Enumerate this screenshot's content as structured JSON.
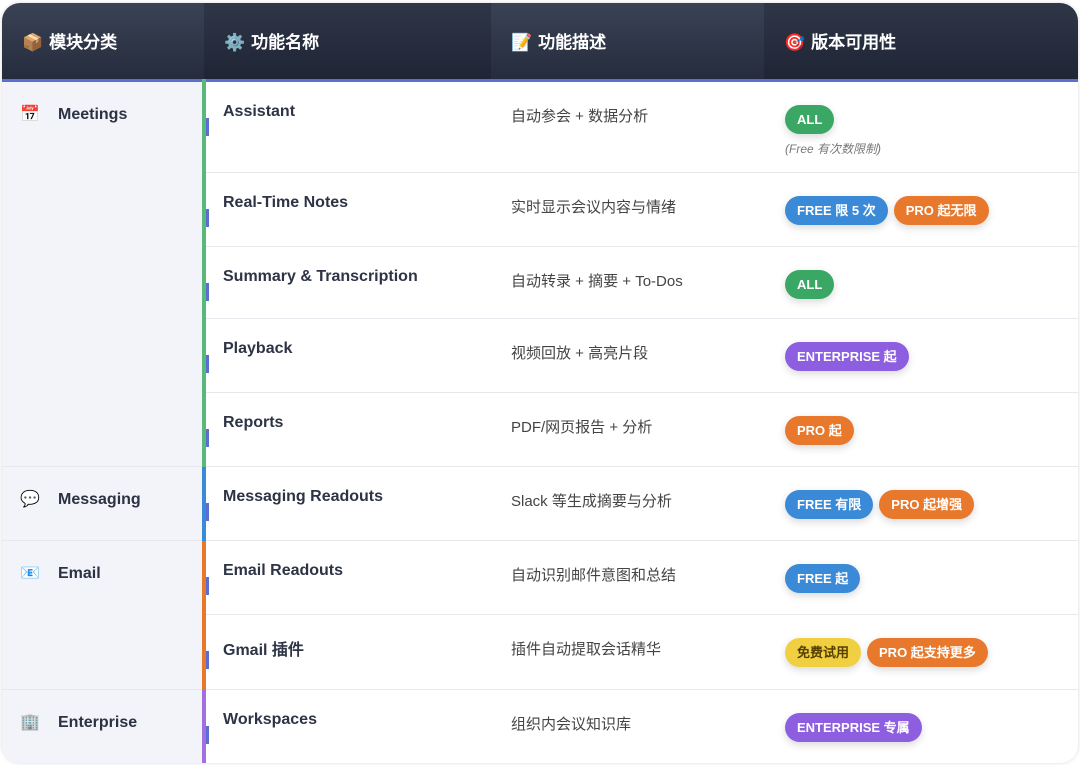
{
  "headers": [
    {
      "icon": "📦",
      "label": "模块分类"
    },
    {
      "icon": "⚙️",
      "label": "功能名称"
    },
    {
      "icon": "📝",
      "label": "功能描述"
    },
    {
      "icon": "🎯",
      "label": "版本可用性"
    }
  ],
  "colors": {
    "meetings": "#5ab87a",
    "messaging": "#3a8ad8",
    "email": "#e8782b",
    "enterprise": "#a070e0"
  },
  "groups": [
    {
      "icon": "📅",
      "name": "Meetings",
      "rows": [
        {
          "feature": "Assistant",
          "desc": "自动参会 + 数据分析",
          "badges": [
            {
              "t": "ALL",
              "k": "all"
            }
          ],
          "note": "(Free 有次数限制)"
        },
        {
          "feature": "Real-Time Notes",
          "desc": "实时显示会议内容与情绪",
          "badges": [
            {
              "t": "FREE 限 5 次",
              "k": "free"
            },
            {
              "t": "PRO 起无限",
              "k": "pro"
            }
          ]
        },
        {
          "feature": "Summary & Transcription",
          "desc": "自动转录 + 摘要 + To-Dos",
          "badges": [
            {
              "t": "ALL",
              "k": "all"
            }
          ]
        },
        {
          "feature": "Playback",
          "desc": "视频回放 + 高亮片段",
          "badges": [
            {
              "t": "ENTERPRISE 起",
              "k": "ent"
            }
          ]
        },
        {
          "feature": "Reports",
          "desc": "PDF/网页报告 + 分析",
          "badges": [
            {
              "t": "PRO 起",
              "k": "pro"
            }
          ]
        }
      ]
    },
    {
      "icon": "💬",
      "name": "Messaging",
      "rows": [
        {
          "feature": "Messaging Readouts",
          "desc": "Slack 等生成摘要与分析",
          "badges": [
            {
              "t": "FREE 有限",
              "k": "free"
            },
            {
              "t": "PRO 起增强",
              "k": "pro"
            }
          ]
        }
      ]
    },
    {
      "icon": "📧",
      "name": "Email",
      "rows": [
        {
          "feature": "Email Readouts",
          "desc": "自动识别邮件意图和总结",
          "badges": [
            {
              "t": "FREE 起",
              "k": "free"
            }
          ]
        },
        {
          "feature": "Gmail 插件",
          "desc": "插件自动提取会话精华",
          "badges": [
            {
              "t": "免费试用",
              "k": "trial"
            },
            {
              "t": "PRO 起支持更多",
              "k": "pro"
            }
          ]
        }
      ]
    },
    {
      "icon": "🏢",
      "name": "Enterprise",
      "rows": [
        {
          "feature": "Workspaces",
          "desc": "组织内会议知识库",
          "badges": [
            {
              "t": "ENTERPRISE 专属",
              "k": "ent"
            }
          ]
        }
      ]
    }
  ]
}
